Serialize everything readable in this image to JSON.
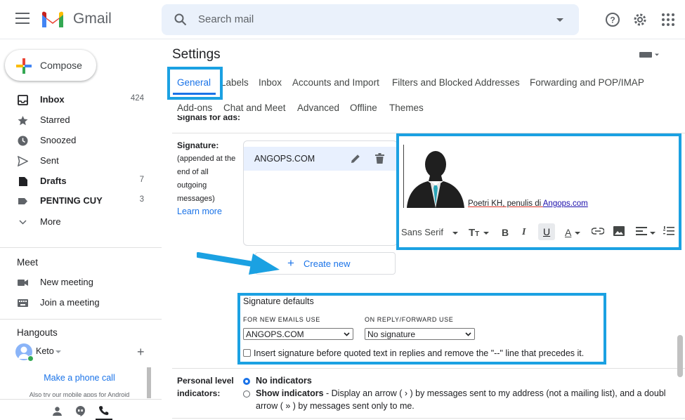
{
  "app": {
    "name": "Gmail"
  },
  "search": {
    "placeholder": "Search mail"
  },
  "compose": {
    "label": "Compose"
  },
  "nav": [
    {
      "label": "Inbox",
      "count": "424",
      "bold": true,
      "icon": "inbox-icon"
    },
    {
      "label": "Starred",
      "count": "",
      "bold": false,
      "icon": "star-icon"
    },
    {
      "label": "Snoozed",
      "count": "",
      "bold": false,
      "icon": "clock-icon"
    },
    {
      "label": "Sent",
      "count": "",
      "bold": false,
      "icon": "send-icon"
    },
    {
      "label": "Drafts",
      "count": "7",
      "bold": true,
      "icon": "draft-icon"
    },
    {
      "label": "PENTING CUY",
      "count": "3",
      "bold": true,
      "icon": "label-icon"
    },
    {
      "label": "More",
      "count": "",
      "bold": false,
      "icon": "chevron-down-icon"
    }
  ],
  "meet": {
    "heading": "Meet",
    "new_meeting": "New meeting",
    "join_meeting": "Join a meeting"
  },
  "hangouts": {
    "heading": "Hangouts",
    "user": "Keto",
    "phone_call": "Make a phone call",
    "promo": "Also try our mobile apps for Android"
  },
  "settings": {
    "title": "Settings",
    "tabs_row1": [
      "General",
      "Labels",
      "Inbox",
      "Accounts and Import",
      "Filters and Blocked Addresses",
      "Forwarding and POP/IMAP"
    ],
    "tabs_row2": [
      "Add-ons",
      "Chat and Meet",
      "Advanced",
      "Offline",
      "Themes"
    ],
    "cut_label": "Signals for ads:",
    "signature": {
      "label": "Signature:",
      "desc": [
        "(appended at the",
        "end of all",
        "outgoing",
        "messages)"
      ],
      "learn_more": "Learn more",
      "item": "ANGOPS.COM",
      "preview_text": "Poetri KH, penulis di ",
      "preview_link": "Angops.com",
      "font": "Sans Serif",
      "create_new": "Create new"
    },
    "defaults": {
      "heading": "Signature defaults",
      "new_label": "FOR NEW EMAILS USE",
      "new_value": "ANGOPS.COM",
      "reply_label": "ON REPLY/FORWARD USE",
      "reply_value": "No signature",
      "checkbox": "Insert signature before quoted text in replies and remove the \"--\" line that precedes it."
    },
    "indicators": {
      "label1": "Personal level",
      "label2": "indicators:",
      "opt1": "No indicators",
      "opt2_bold": "Show indicators",
      "opt2_rest": " - Display an arrow ( › ) by messages sent to my address (not a mailing list), and a doubl",
      "opt2_line2": "arrow ( » ) by messages sent only to me."
    }
  },
  "colors": {
    "highlight": "#1ba1e2",
    "accent": "#1a73e8"
  }
}
